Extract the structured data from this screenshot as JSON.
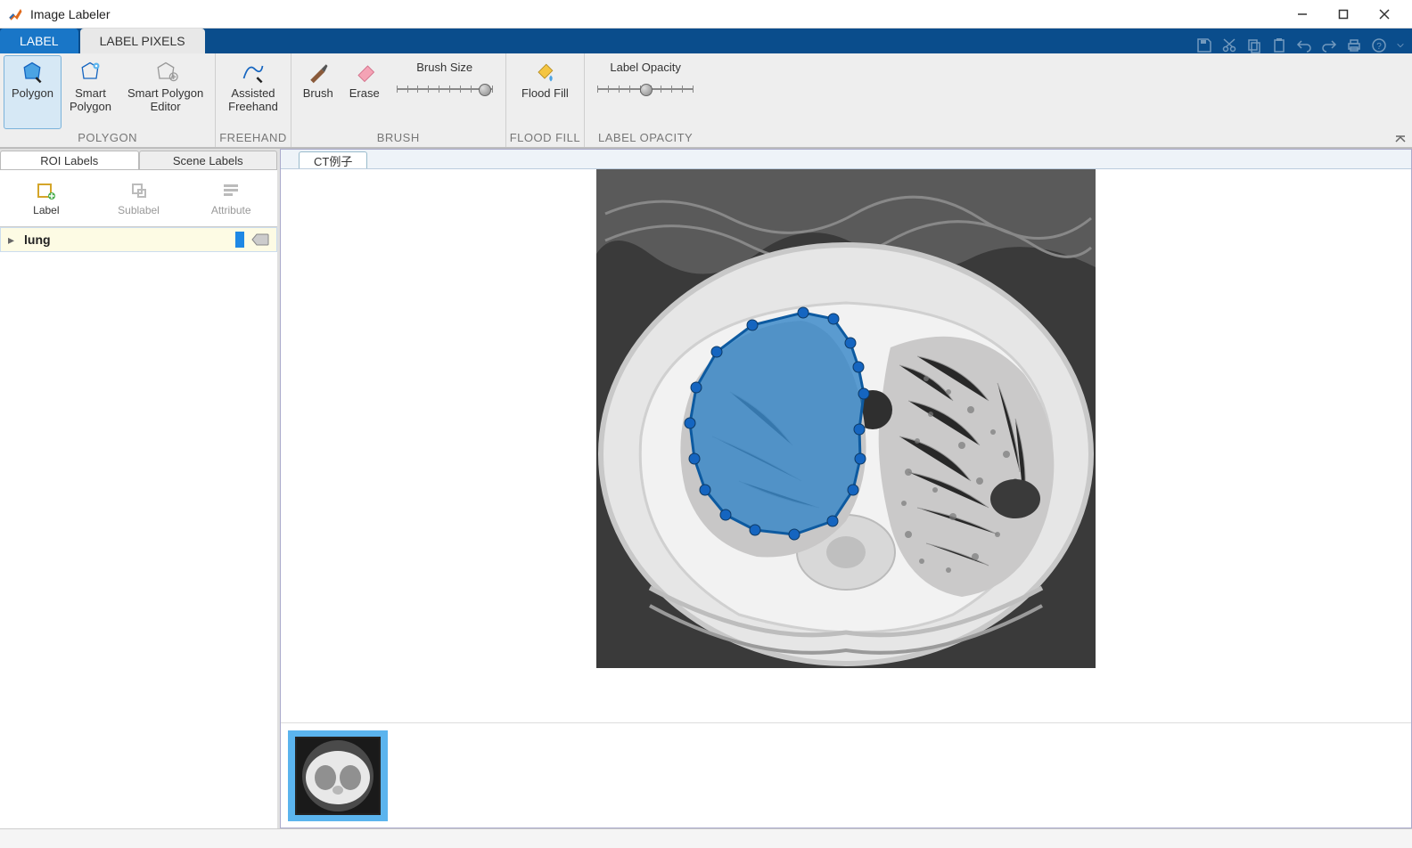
{
  "window": {
    "title": "Image Labeler"
  },
  "tabs": {
    "label": "LABEL",
    "label_pixels": "LABEL PIXELS"
  },
  "ribbon": {
    "polygon_group": "POLYGON",
    "freehand_group": "FREEHAND",
    "brush_group": "BRUSH",
    "floodfill_group": "FLOOD FILL",
    "opacity_group": "LABEL OPACITY",
    "polygon": "Polygon",
    "smart_polygon_l1": "Smart",
    "smart_polygon_l2": "Polygon",
    "smart_editor_l1": "Smart Polygon",
    "smart_editor_l2": "Editor",
    "assisted_l1": "Assisted",
    "assisted_l2": "Freehand",
    "brush": "Brush",
    "erase": "Erase",
    "brush_size": "Brush Size",
    "flood_fill": "Flood Fill",
    "label_opacity": "Label Opacity"
  },
  "left": {
    "tab_roi": "ROI Labels",
    "tab_scene": "Scene Labels",
    "btn_label": "Label",
    "btn_sublabel": "Sublabel",
    "btn_attribute": "Attribute",
    "label_name": "lung"
  },
  "document": {
    "tab": "CT例子"
  }
}
